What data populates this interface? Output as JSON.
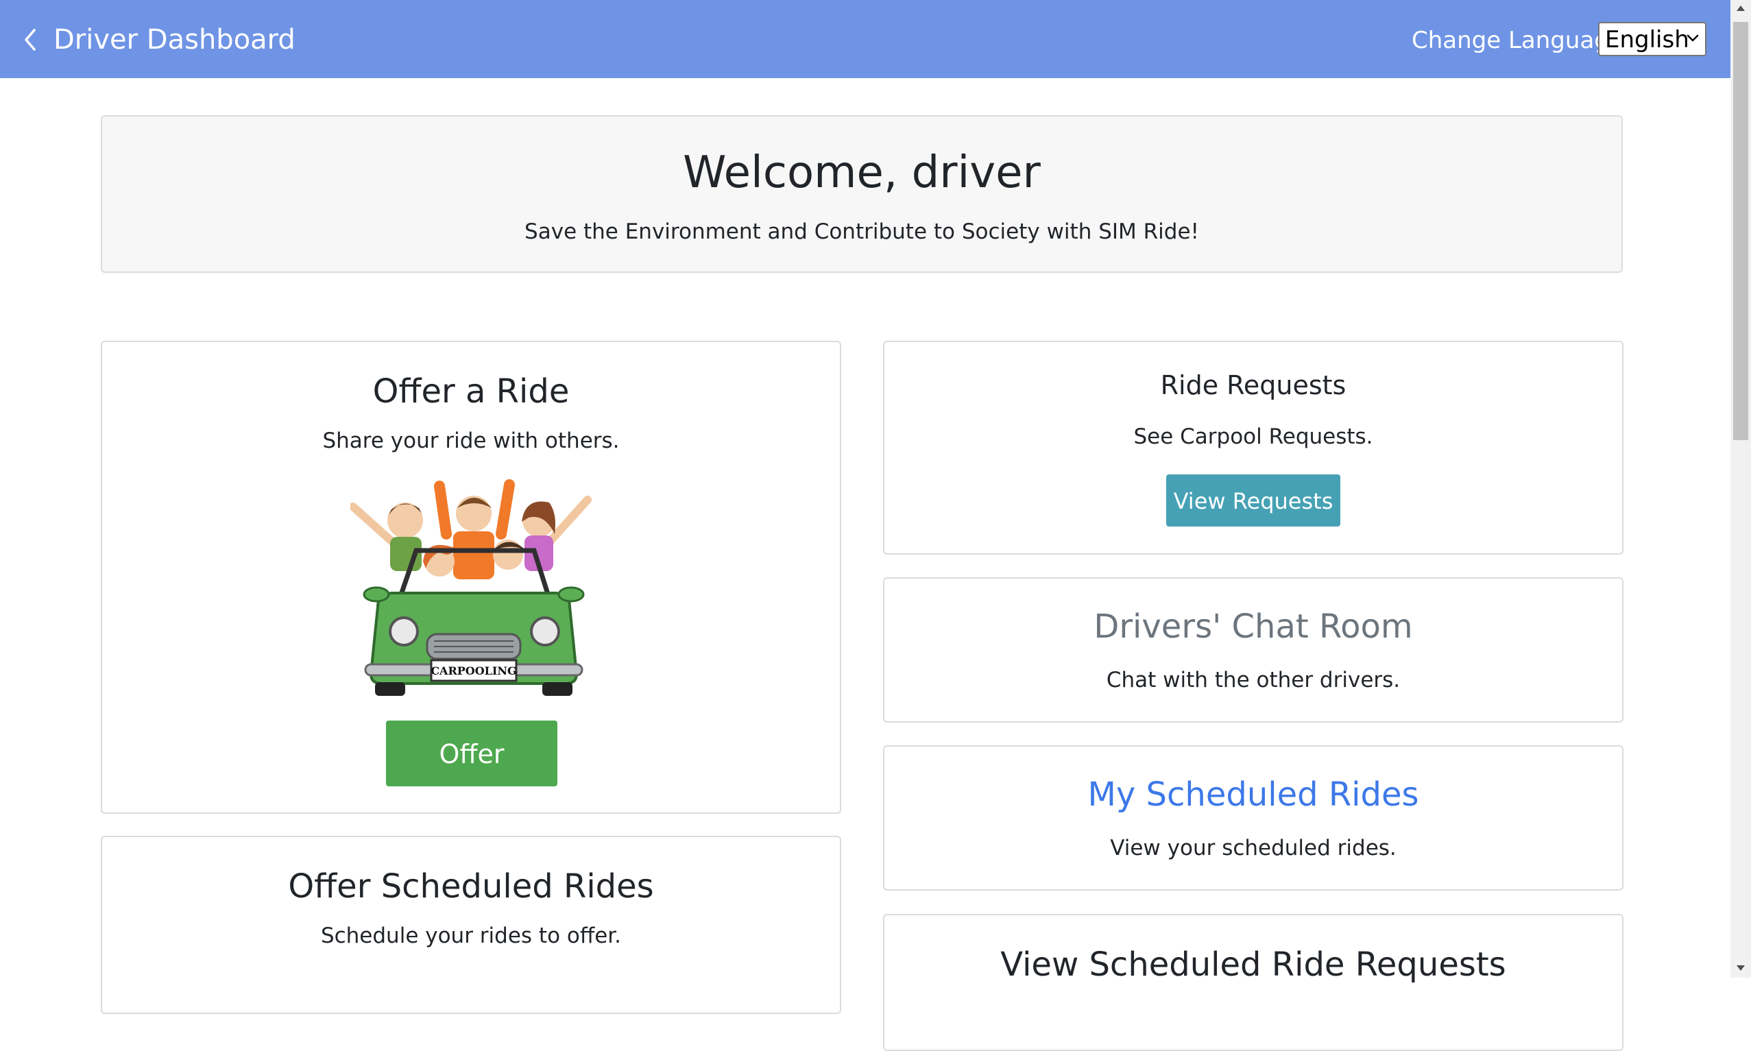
{
  "header": {
    "title": "Driver Dashboard",
    "back_icon": "chevron-left-icon",
    "language_label": "Change Language:",
    "language_value": "English"
  },
  "welcome": {
    "heading": "Welcome, driver",
    "subtitle": "Save the Environment and Contribute to Society with SIM Ride!"
  },
  "cards": {
    "offer_ride": {
      "title": "Offer a Ride",
      "text": "Share your ride with others.",
      "image_badge": "CARPOOLING",
      "button": "Offer"
    },
    "offer_scheduled": {
      "title": "Offer Scheduled Rides",
      "text": "Schedule your rides to offer."
    },
    "ride_requests": {
      "title": "Ride Requests",
      "text": "See Carpool Requests.",
      "button": "View Requests"
    },
    "chat_room": {
      "title": "Drivers' Chat Room",
      "text": "Chat with the other drivers."
    },
    "my_scheduled": {
      "title": "My Scheduled Rides",
      "text": "View your scheduled rides."
    },
    "view_scheduled_requests": {
      "title": "View Scheduled Ride Requests"
    }
  },
  "colors": {
    "header_bg": "#6f94e5",
    "offer_button": "#4ea84f",
    "view_button": "#46a1b5",
    "link_blue": "#3c78e8",
    "muted_gray": "#6c757d"
  }
}
